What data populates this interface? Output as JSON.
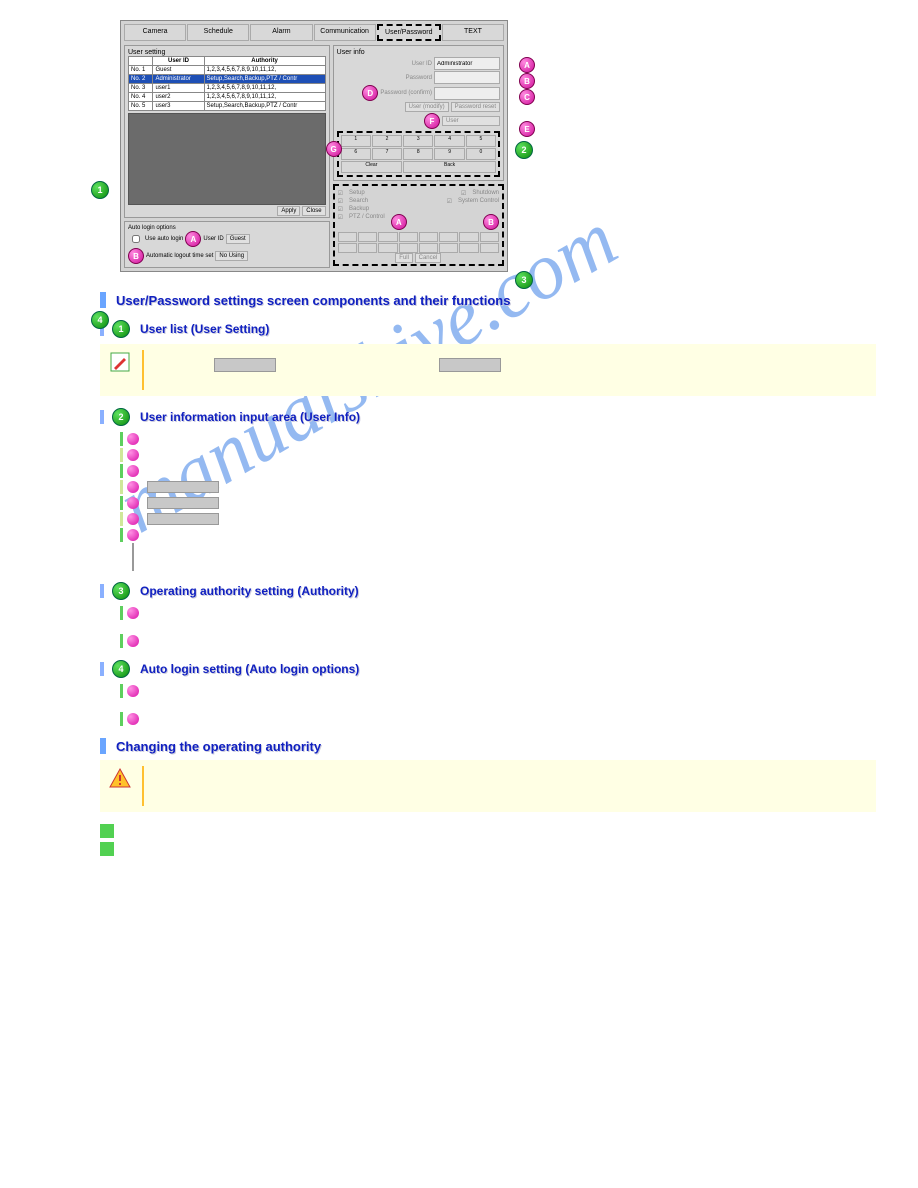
{
  "screenshot": {
    "tabs": [
      "Camera",
      "Schedule",
      "Alarm",
      "Communication",
      "User/Password",
      "TEXT"
    ],
    "active_tab": 4,
    "user_setting_label": "User setting",
    "table": {
      "headers": [
        "",
        "User ID",
        "Authority"
      ],
      "rows": [
        {
          "no": "No. 1",
          "id": "Guest",
          "auth": "1,2,3,4,5,6,7,8,9,10,11,12,"
        },
        {
          "no": "No. 2",
          "id": "Administrator",
          "auth": "Setup,Search,Backup,PTZ / Contr"
        },
        {
          "no": "No. 3",
          "id": "user1",
          "auth": "1,2,3,4,5,6,7,8,9,10,11,12,"
        },
        {
          "no": "No. 4",
          "id": "user2",
          "auth": "1,2,3,4,5,6,7,8,9,10,11,12,"
        },
        {
          "no": "No. 5",
          "id": "user3",
          "auth": "Setup,Search,Backup,PTZ / Contr"
        }
      ],
      "selected": 1
    },
    "user_info": {
      "label": "User info",
      "fields": {
        "user_id_label": "User ID",
        "user_id_value": "Administrator",
        "password_label": "Password",
        "password_value": "",
        "confirm_label": "Password (confirm)",
        "confirm_value": ""
      },
      "btn_modify": "User (modify)",
      "btn_reset": "Password reset",
      "user_label": "User"
    },
    "keypad": [
      "1",
      "2",
      "3",
      "4",
      "5",
      "6",
      "7",
      "8",
      "9",
      "0",
      "Clear",
      "",
      "Back",
      "",
      " "
    ],
    "authority": {
      "items": [
        "Setup",
        "Shutdown",
        "Search",
        "System Control",
        "Backup",
        "PTZ / Control"
      ],
      "cams": 16,
      "btn_full": "Full",
      "btn_cancel": "Cancel"
    },
    "autologin": {
      "label": "Auto login options",
      "cb": "Use auto login",
      "userid_label": "User ID",
      "userid_val": "Guest",
      "timeout_label": "Automatic logout time set",
      "timeout_val": "No Using"
    },
    "footer_btns": {
      "apply": "Apply",
      "close": "Close"
    }
  },
  "headings": {
    "main": "User/Password settings screen components and their functions",
    "s1": "User list (User Setting)",
    "s2": "User information input area (User Info)",
    "s3": "Operating authority setting (Authority)",
    "s4": "Auto login setting (Auto login options)",
    "s5": "Changing the operating authority"
  },
  "callout_nums": {
    "1": "1",
    "2": "2",
    "3": "3",
    "4": "4"
  },
  "callout_letters": {
    "A": "A",
    "B": "B",
    "C": "C",
    "D": "D",
    "E": "E",
    "F": "F",
    "G": "G"
  },
  "watermark": "manualshive.com"
}
